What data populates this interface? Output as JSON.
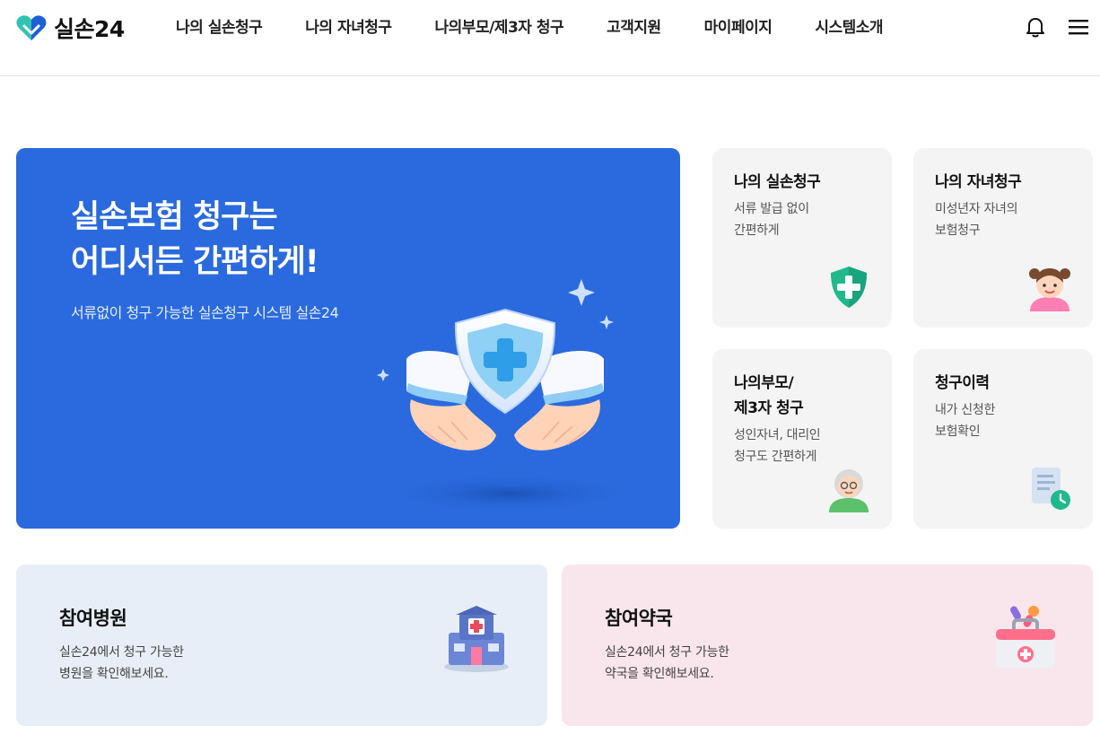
{
  "header": {
    "logo_text": "실손24",
    "nav": [
      {
        "label": "나의 실손청구"
      },
      {
        "label": "나의 자녀청구"
      },
      {
        "label": "나의부모/제3자 청구"
      },
      {
        "label": "고객지원"
      },
      {
        "label": "마이페이지"
      },
      {
        "label": "시스템소개"
      }
    ],
    "icons": [
      "bell-icon",
      "menu-icon"
    ]
  },
  "hero": {
    "title_line1": "실손보험 청구는",
    "title_line2": "어디서든 간편하게!",
    "subtitle": "서류없이 청구 가능한 실손청구 시스템 실손24",
    "bg_color": "#2a6ade"
  },
  "cards": [
    {
      "title": "나의 실손청구",
      "desc": "서류 발급 없이\n간편하게",
      "icon": "shield-plus-icon"
    },
    {
      "title": "나의 자녀청구",
      "desc": "미성년자 자녀의\n보험청구",
      "icon": "child-icon"
    },
    {
      "title": "나의부모/\n제3자 청구",
      "desc": "성인자녀, 대리인\n청구도 간편하게",
      "icon": "grandparent-icon"
    },
    {
      "title": "청구이력",
      "desc": "내가 신청한\n보험확인",
      "icon": "document-clock-icon"
    }
  ],
  "bottom": [
    {
      "title": "참여병원",
      "desc": "실손24에서 청구 가능한\n병원을 확인해보세요.",
      "icon": "hospital-icon",
      "bg_color": "#e8eef8"
    },
    {
      "title": "참여약국",
      "desc": "실손24에서 청구 가능한\n약국을 확인해보세요.",
      "icon": "first-aid-kit-icon",
      "bg_color": "#f9e6ec"
    }
  ]
}
